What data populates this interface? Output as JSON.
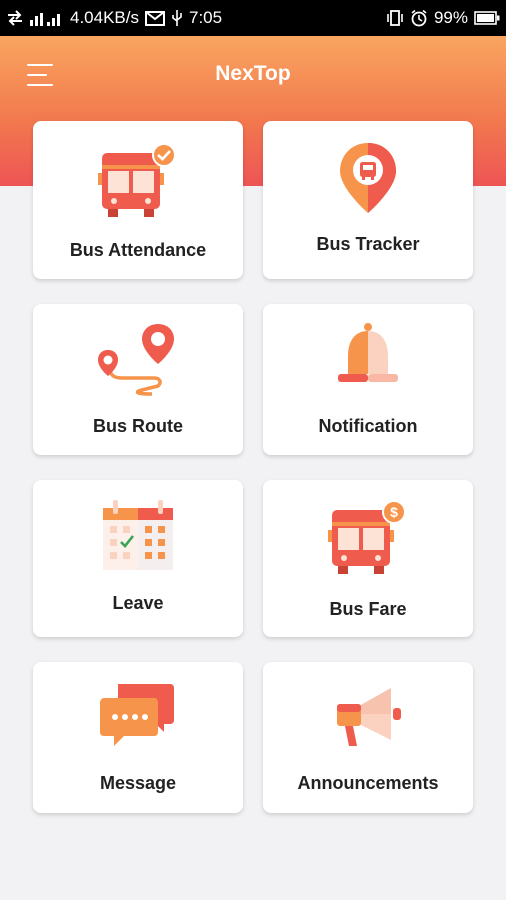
{
  "status_bar": {
    "network_speed": "4.04KB/s",
    "time": "7:05",
    "battery": "99%"
  },
  "header": {
    "title": "NexTop"
  },
  "tiles": [
    {
      "label": "Bus Attendance",
      "icon": "bus-check-icon"
    },
    {
      "label": "Bus Tracker",
      "icon": "location-pin-bus-icon"
    },
    {
      "label": "Bus Route",
      "icon": "route-map-icon"
    },
    {
      "label": "Notification",
      "icon": "bell-icon"
    },
    {
      "label": "Leave",
      "icon": "calendar-icon"
    },
    {
      "label": "Bus Fare",
      "icon": "bus-dollar-icon"
    },
    {
      "label": "Message",
      "icon": "chat-bubbles-icon"
    },
    {
      "label": "Announcements",
      "icon": "megaphone-icon"
    }
  ],
  "colors": {
    "accent_orange": "#f7944b",
    "accent_red": "#ee5455",
    "light_peach": "#fbd2c0"
  }
}
